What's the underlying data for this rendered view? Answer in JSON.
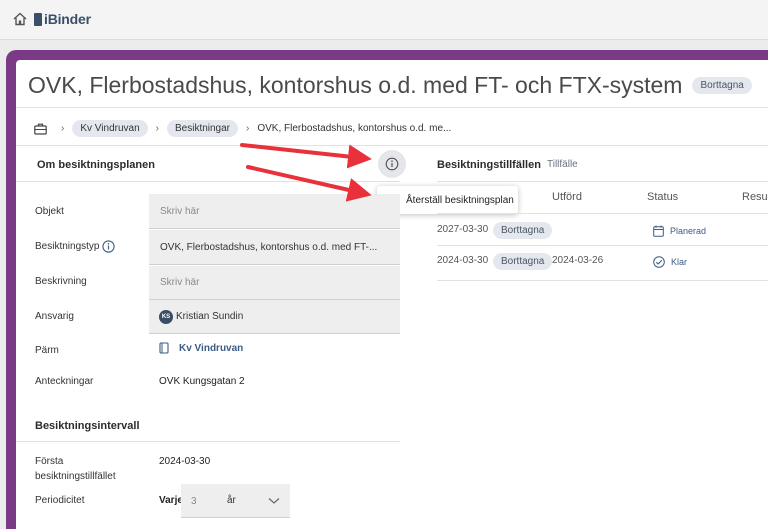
{
  "app": {
    "brand": "iBinder",
    "icons": {
      "home": "home-icon",
      "logo": "ibinder-logo-icon"
    }
  },
  "page": {
    "title": "OVK, Flerbostadshus, kontorshus o.d. med FT- och FTX-system",
    "status_badge": "Borttagna"
  },
  "breadcrumb": {
    "items": [
      "Kv Vindruvan",
      "Besiktningar",
      "OVK, Flerbostadshus, kontorshus o.d. me..."
    ],
    "icons": {
      "root": "briefcase-icon",
      "separator": "chevron-right-icon"
    }
  },
  "about": {
    "title": "Om besiktningsplanen",
    "info_icon": "info-icon",
    "menu": {
      "item_label": "Återställ besiktningsplan",
      "item_icon": "undo-icon"
    },
    "fields": {
      "objekt": {
        "label": "Objekt",
        "placeholder": "Skriv här"
      },
      "typ": {
        "label": "Besiktningstyp",
        "value": "OVK, Flerbostadshus, kontorshus o.d. med FT-..."
      },
      "beskrivning": {
        "label": "Beskrivning",
        "placeholder": "Skriv här"
      },
      "ansvarig": {
        "label": "Ansvarig",
        "initials": "KS",
        "value": "Kristian Sundin"
      },
      "parm": {
        "label": "Pärm",
        "value": "Kv Vindruvan",
        "icon": "binder-icon"
      },
      "anteckningar": {
        "label": "Anteckningar",
        "value": "OVK Kungsgatan 2"
      }
    }
  },
  "interval": {
    "title": "Besiktningsintervall",
    "forsta": {
      "label_line1": "Första",
      "label_line2": "besiktningstillfället",
      "value": "2024-03-30"
    },
    "periodicitet": {
      "label": "Periodicitet",
      "prefix": "Varje",
      "number": "3",
      "unit": "år"
    }
  },
  "occasions": {
    "title": "Besiktningstillfällen",
    "subtitle": "Tillfälle",
    "columns": [
      "Utförd",
      "Status",
      "Resul"
    ],
    "rows": [
      {
        "date": "2027-03-30",
        "badge": "Borttagna",
        "performed": "",
        "status": "Planerad",
        "status_icon": "calendar-icon"
      },
      {
        "date": "2024-03-30",
        "badge": "Borttagna",
        "performed": "2024-03-26",
        "status": "Klar",
        "status_icon": "check-circle-icon"
      }
    ]
  },
  "colors": {
    "frame": "#7b3a86",
    "accent": "#3c5c84",
    "arrow": "#e8313b",
    "badge": "#e4e8ee"
  }
}
